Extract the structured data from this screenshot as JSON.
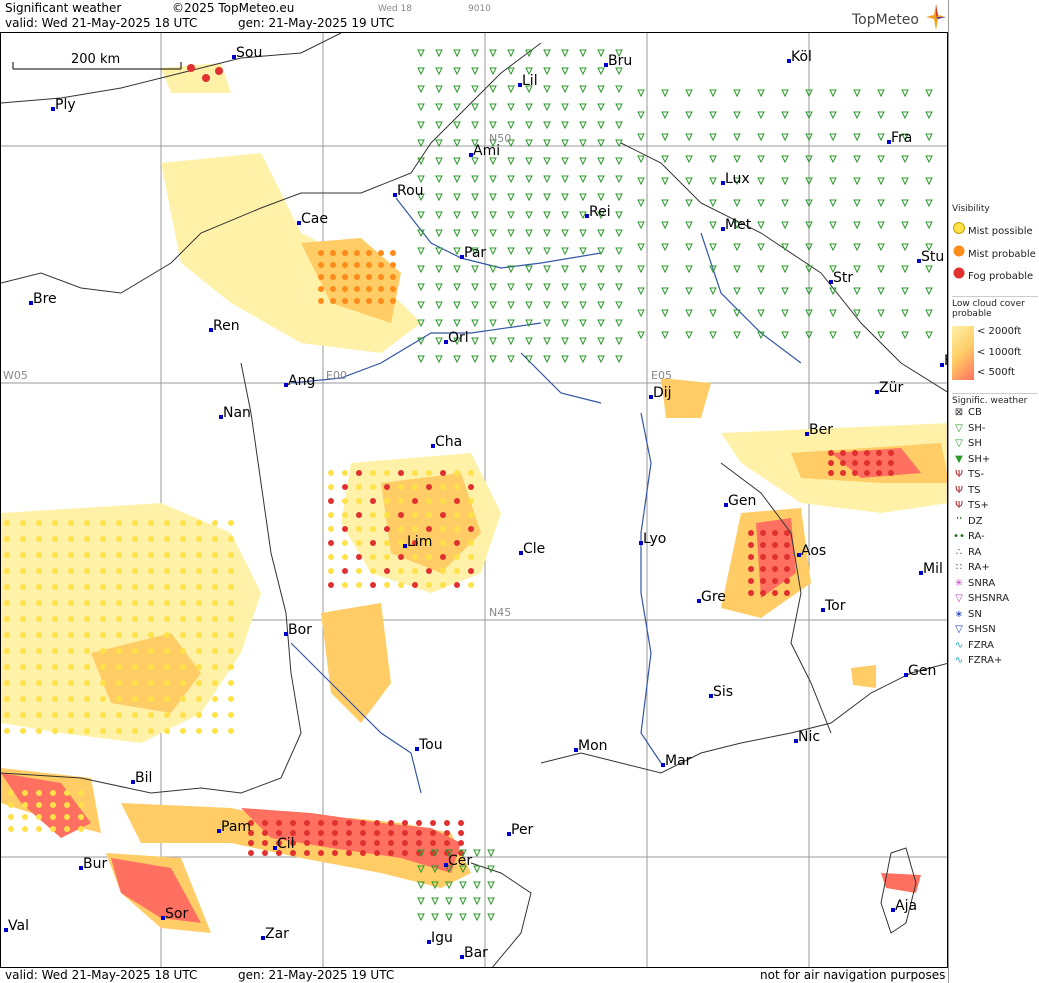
{
  "header": {
    "title": "Significant weather",
    "copyright": "©2025 TopMeteo.eu",
    "day_code": "Wed 18",
    "code": "9010",
    "valid": "valid:  Wed  21-May-2025  18 UTC",
    "gen": "gen: 21-May-2025 19 UTC",
    "logo": "TopMeteo"
  },
  "footer": {
    "valid": "valid:  Wed  21-May-2025  18 UTC",
    "gen": "gen: 21-May-2025 19 UTC",
    "note": "not for air navigation purposes"
  },
  "map": {
    "scale_label": "200 km",
    "grid_labels": [
      "N50",
      "N45",
      "W05",
      "E00",
      "E05"
    ],
    "cities": [
      {
        "name": "Sou"
      },
      {
        "name": "Ply"
      },
      {
        "name": "Lil"
      },
      {
        "name": "Bru"
      },
      {
        "name": "Köl"
      },
      {
        "name": "Ami"
      },
      {
        "name": "Fra"
      },
      {
        "name": "Rou"
      },
      {
        "name": "Lux"
      },
      {
        "name": "Cae"
      },
      {
        "name": "Rei"
      },
      {
        "name": "Met"
      },
      {
        "name": "Par"
      },
      {
        "name": "Stu"
      },
      {
        "name": "Bre"
      },
      {
        "name": "Str"
      },
      {
        "name": "Ren"
      },
      {
        "name": "Orl"
      },
      {
        "name": "Ang"
      },
      {
        "name": "Zür"
      },
      {
        "name": "Dij"
      },
      {
        "name": "Nan"
      },
      {
        "name": "Ber"
      },
      {
        "name": "Cha"
      },
      {
        "name": "Gen"
      },
      {
        "name": "Lim"
      },
      {
        "name": "Cle"
      },
      {
        "name": "Lyo"
      },
      {
        "name": "Aos"
      },
      {
        "name": "Mil"
      },
      {
        "name": "Gre"
      },
      {
        "name": "Tor"
      },
      {
        "name": "Bor"
      },
      {
        "name": "Gen"
      },
      {
        "name": "Sis"
      },
      {
        "name": "Nic"
      },
      {
        "name": "Tou"
      },
      {
        "name": "Mon"
      },
      {
        "name": "Mar"
      },
      {
        "name": "Bil"
      },
      {
        "name": "Pam"
      },
      {
        "name": "Per"
      },
      {
        "name": "Cil"
      },
      {
        "name": "Bur"
      },
      {
        "name": "Cer"
      },
      {
        "name": "Sor"
      },
      {
        "name": "Val"
      },
      {
        "name": "Zar"
      },
      {
        "name": "Aja"
      },
      {
        "name": "Igu"
      },
      {
        "name": "Bar"
      },
      {
        "name": "F"
      }
    ]
  },
  "legend": {
    "visibility_title": "Visibility",
    "visibility": [
      {
        "label": "Mist possible",
        "color": "#ffe24a"
      },
      {
        "label": "Mist probable",
        "color": "#ff8c1a"
      },
      {
        "label": "Fog probable",
        "color": "#e03030"
      }
    ],
    "lowcloud_title": "Low cloud cover probable",
    "lowcloud": [
      {
        "label": "< 2000ft",
        "color": "#fff2a8"
      },
      {
        "label": "< 1000ft",
        "color": "#ffcc66"
      },
      {
        "label": "<  500ft",
        "color": "#ff7060"
      }
    ],
    "sigwx_title": "Signific. weather",
    "sigwx": [
      {
        "label": "CB",
        "icon": "cb-icon"
      },
      {
        "label": "SH-",
        "icon": "shower-light-icon"
      },
      {
        "label": "SH",
        "icon": "shower-icon"
      },
      {
        "label": "SH+",
        "icon": "shower-heavy-icon"
      },
      {
        "label": "TS-",
        "icon": "thunderstorm-light-icon"
      },
      {
        "label": "TS",
        "icon": "thunderstorm-icon"
      },
      {
        "label": "TS+",
        "icon": "thunderstorm-heavy-icon"
      },
      {
        "label": "DZ",
        "icon": "drizzle-icon"
      },
      {
        "label": "RA-",
        "icon": "rain-light-icon"
      },
      {
        "label": "RA",
        "icon": "rain-icon"
      },
      {
        "label": "RA+",
        "icon": "rain-heavy-icon"
      },
      {
        "label": "SNRA",
        "icon": "snow-rain-icon"
      },
      {
        "label": "SHSNRA",
        "icon": "snow-rain-shower-icon"
      },
      {
        "label": "SN",
        "icon": "snow-icon"
      },
      {
        "label": "SHSN",
        "icon": "snow-shower-icon"
      },
      {
        "label": "FZRA",
        "icon": "freezing-rain-icon"
      },
      {
        "label": "FZRA+",
        "icon": "freezing-rain-heavy-icon"
      }
    ]
  }
}
